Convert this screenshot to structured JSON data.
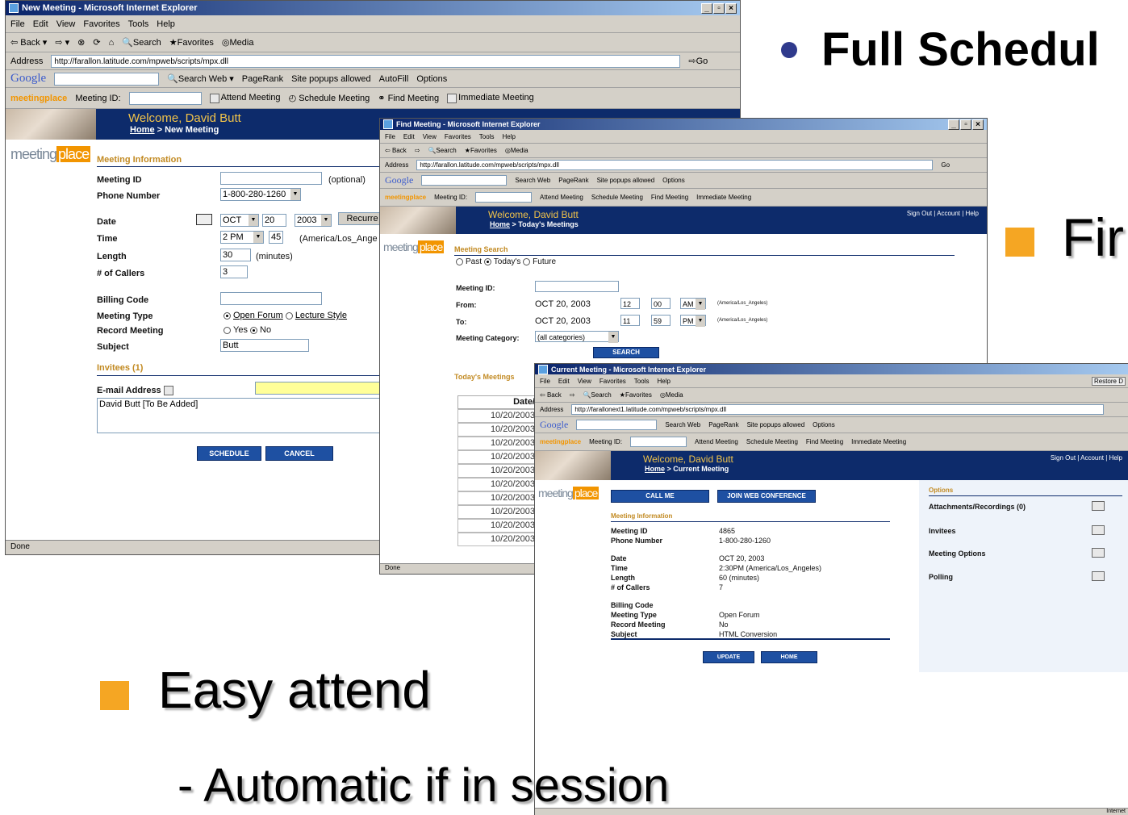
{
  "slide": {
    "title": "Full Schedul",
    "fin": "Fir",
    "easy": "Easy attend",
    "automatic": "- Automatic if in session"
  },
  "ie_common": {
    "menu": [
      "File",
      "Edit",
      "View",
      "Favorites",
      "Tools",
      "Help"
    ],
    "back": "Back",
    "search": "Search",
    "favorites": "Favorites",
    "media": "Media",
    "address_label": "Address",
    "go": "Go",
    "google": "Google",
    "search_web": "Search Web",
    "pagerank": "PageRank",
    "popups": "Site popups allowed",
    "autofill": "AutoFill",
    "options": "Options",
    "meetingplace": "meetingplace",
    "meeting_id_label": "Meeting ID:",
    "attend": "Attend Meeting",
    "schedule": "Schedule Meeting",
    "find": "Find Meeting",
    "immediate": "Immediate Meeting",
    "done": "Done",
    "welcome": "Welcome, David Butt",
    "home": "Home",
    "header_links": "Sign Out | Account | Help"
  },
  "win1": {
    "title": "New Meeting - Microsoft Internet Explorer",
    "url": "http://farallon.latitude.com/mpweb/scripts/mpx.dll",
    "crumb_page": "New Meeting",
    "section_info": "Meeting Information",
    "labels": {
      "meeting_id": "Meeting ID",
      "phone": "Phone Number",
      "date": "Date",
      "time": "Time",
      "length": "Length",
      "callers": "# of Callers",
      "billing": "Billing Code",
      "type": "Meeting Type",
      "record": "Record Meeting",
      "subject": "Subject",
      "invitees": "Invitees  (1)",
      "email": "E-mail Address"
    },
    "values": {
      "optional": "(optional)",
      "phone": "1-800-280-1260",
      "month": "OCT",
      "day": "20",
      "year": "2003",
      "recurrence": "Recurre",
      "hour": "2 PM",
      "minute": "45",
      "tz": "(America/Los_Ange",
      "length": "30",
      "minutes": "(minutes)",
      "callers": "3",
      "open_forum": "Open Forum",
      "lecture": "Lecture Style",
      "yes": "Yes",
      "no": "No",
      "subject": "Butt",
      "invitee": "David Butt [To Be Added]"
    },
    "buttons": {
      "schedule": "SCHEDULE",
      "cancel": "CANCEL"
    }
  },
  "win2": {
    "title": "Find Meeting - Microsoft Internet Explorer",
    "url": "http://farallon.latitude.com/mpweb/scripts/mpx.dll",
    "crumb_page": "Today's Meetings",
    "section_search": "Meeting Search",
    "past": "Past",
    "today": "Today's",
    "future": "Future",
    "meeting_id": "Meeting ID:",
    "from": "From:",
    "to": "To:",
    "category": "Meeting Category:",
    "from_date": "OCT  20,  2003",
    "from_h": "12",
    "from_m": "00",
    "from_ampm": "AM",
    "to_date": "OCT  20,  2003",
    "to_h": "11",
    "to_m": "59",
    "to_ampm": "PM",
    "tz": "(America/Los_Angeles)",
    "category_val": "(all categories)",
    "search_btn": "SEARCH",
    "todays_title": "Today's Meetings",
    "date_col": "Date/",
    "dates": [
      "10/20/2003",
      "10/20/2003",
      "10/20/2003",
      "10/20/2003",
      "10/20/2003",
      "10/20/2003",
      "10/20/2003",
      "10/20/2003",
      "10/20/2003",
      "10/20/2003"
    ]
  },
  "win3": {
    "title": "Current Meeting - Microsoft Internet Explorer",
    "url": "http://farallonext1.latitude.com/mpweb/scripts/mpx.dll",
    "crumb_page": "Current Meeting",
    "restore": "Restore D",
    "call_me": "CALL ME",
    "join_web": "JOIN WEB CONFERENCE",
    "section_info": "Meeting Information",
    "labels": [
      "Meeting ID",
      "Phone Number",
      "Date",
      "Time",
      "Length",
      "# of Callers",
      "Billing Code",
      "Meeting Type",
      "Record Meeting",
      "Subject"
    ],
    "values": [
      "4865",
      "1-800-280-1260",
      "OCT 20, 2003",
      "2:30PM  (America/Los_Angeles)",
      "60 (minutes)",
      "7",
      "",
      "Open Forum",
      "No",
      "HTML Conversion"
    ],
    "update": "UPDATE",
    "home_btn": "HOME",
    "options_title": "Options",
    "options": [
      "Attachments/Recordings (0)",
      "Invitees",
      "Meeting Options",
      "Polling"
    ],
    "internet": "Internet"
  }
}
